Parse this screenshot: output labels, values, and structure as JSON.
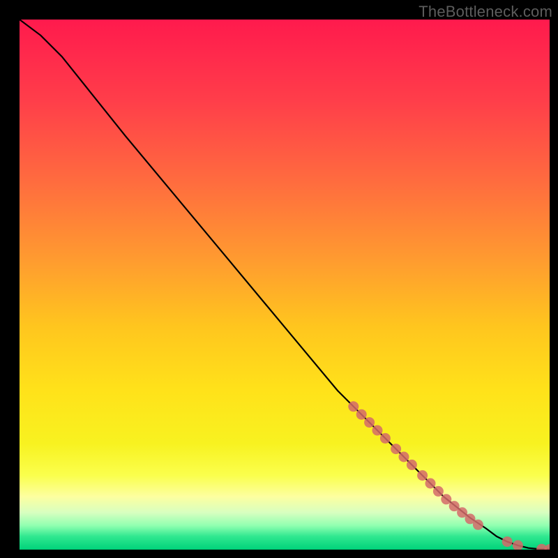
{
  "watermark": "TheBottleneck.com",
  "chart_data": {
    "type": "line",
    "title": "",
    "xlabel": "",
    "ylabel": "",
    "xlim": [
      0,
      100
    ],
    "ylim": [
      0,
      100
    ],
    "curve": {
      "name": "bottleneck-curve",
      "x": [
        0,
        4,
        8,
        12,
        20,
        30,
        40,
        50,
        60,
        65,
        70,
        75,
        80,
        85,
        88,
        90,
        92,
        94,
        96,
        98,
        100
      ],
      "y": [
        100,
        97,
        93,
        88,
        78,
        66,
        54,
        42,
        30,
        25,
        20,
        15,
        10,
        6,
        4,
        2.5,
        1.5,
        0.8,
        0.3,
        0.1,
        0.05
      ]
    },
    "markers": {
      "name": "highlighted-range",
      "color": "#d46a6a",
      "points": [
        {
          "x": 63,
          "y": 27
        },
        {
          "x": 64.5,
          "y": 25.5
        },
        {
          "x": 66,
          "y": 24
        },
        {
          "x": 67.5,
          "y": 22.5
        },
        {
          "x": 69,
          "y": 21
        },
        {
          "x": 71,
          "y": 19
        },
        {
          "x": 72.5,
          "y": 17.5
        },
        {
          "x": 74,
          "y": 16
        },
        {
          "x": 76,
          "y": 14
        },
        {
          "x": 77.5,
          "y": 12.5
        },
        {
          "x": 79,
          "y": 11
        },
        {
          "x": 80.5,
          "y": 9.5
        },
        {
          "x": 82,
          "y": 8.2
        },
        {
          "x": 83.5,
          "y": 7
        },
        {
          "x": 85,
          "y": 5.8
        },
        {
          "x": 86.5,
          "y": 4.7
        },
        {
          "x": 92,
          "y": 1.5
        },
        {
          "x": 94,
          "y": 0.8
        },
        {
          "x": 98.5,
          "y": 0.1
        },
        {
          "x": 100,
          "y": 0.05
        }
      ]
    },
    "background_gradient": {
      "stops": [
        {
          "offset": 0.0,
          "color": "#ff1a4d"
        },
        {
          "offset": 0.15,
          "color": "#ff3d4a"
        },
        {
          "offset": 0.3,
          "color": "#ff6a3f"
        },
        {
          "offset": 0.45,
          "color": "#ff9a30"
        },
        {
          "offset": 0.58,
          "color": "#ffc61e"
        },
        {
          "offset": 0.7,
          "color": "#ffe21a"
        },
        {
          "offset": 0.8,
          "color": "#f8f220"
        },
        {
          "offset": 0.86,
          "color": "#faff4d"
        },
        {
          "offset": 0.9,
          "color": "#fdffa0"
        },
        {
          "offset": 0.93,
          "color": "#d8ffc0"
        },
        {
          "offset": 0.955,
          "color": "#8fffb0"
        },
        {
          "offset": 0.975,
          "color": "#30e890"
        },
        {
          "offset": 1.0,
          "color": "#00d27a"
        }
      ]
    }
  }
}
